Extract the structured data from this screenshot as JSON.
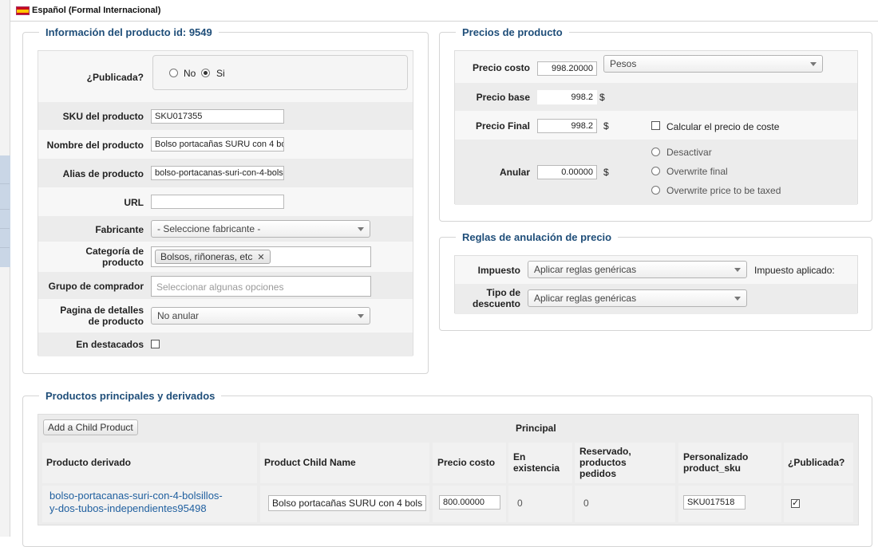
{
  "topbar": {
    "language": "Español (Formal Internacional)"
  },
  "info": {
    "legend": "Información del producto id: 9549",
    "published_label": "¿Publicada?",
    "published_no": "No",
    "published_si": "Si",
    "published_value": "Si",
    "sku_label": "SKU del producto",
    "sku_value": "SKU017355",
    "name_label": "Nombre del producto",
    "name_value": "Bolso portacañas SURU con 4 bo",
    "alias_label": "Alias de producto",
    "alias_value": "bolso-portacanas-suri-con-4-bols",
    "url_label": "URL",
    "url_value": "",
    "manufacturer_label": "Fabricante",
    "manufacturer_value": "- Seleccione fabricante -",
    "category_label_1": "Categoría de",
    "category_label_2": "producto",
    "category_chip": "Bolsos, riñoneras, etc",
    "group_label": "Grupo de comprador",
    "group_placeholder": "Seleccionar algunas opciones",
    "detail_label_1": "Pagina de detalles",
    "detail_label_2": "de producto",
    "detail_value": "No anular",
    "featured_label": "En destacados",
    "featured_checked": false
  },
  "prices": {
    "legend": "Precios de producto",
    "cost_label": "Precio costo",
    "cost_value": "998.20000",
    "currency": "Pesos",
    "base_label": "Precio base",
    "base_value": "998.2",
    "final_label": "Precio Final",
    "final_value": "998.2",
    "dollar": "$",
    "calc_cost_label": "Calcular el precio de coste",
    "override_label": "Anular",
    "override_value": "0.00000",
    "opt_disable": "Desactivar",
    "opt_final": "Overwrite final",
    "opt_taxed": "Overwrite price to be taxed"
  },
  "rules": {
    "legend": "Reglas de anulación de precio",
    "tax_label": "Impuesto",
    "tax_value": "Aplicar reglas genéricas",
    "tax_applied": "Impuesto aplicado:",
    "discount_label_1": "Tipo de",
    "discount_label_2": "descuento",
    "discount_value": "Aplicar reglas genéricas"
  },
  "children": {
    "legend": "Productos principales y derivados",
    "add_button": "Add a Child Product",
    "principal": "Principal",
    "headers": {
      "derived": "Producto derivado",
      "child_name": "Product Child Name",
      "cost": "Precio costo",
      "stock_1": "En",
      "stock_2": "existencia",
      "reserved_1": "Reservado,",
      "reserved_2": "productos",
      "reserved_3": "pedidos",
      "sku_1": "Personalizado",
      "sku_2": "product_sku",
      "published": "¿Publicada?"
    },
    "row": {
      "link_1": "bolso-portacanas-suri-con-4-bolsillos-",
      "link_2": "y-dos-tubos-independientes95498",
      "name": "Bolso portacañas SURU con 4 bols",
      "cost": "800.00000",
      "stock": "0",
      "reserved": "0",
      "sku": "SKU017518",
      "published": true
    }
  }
}
